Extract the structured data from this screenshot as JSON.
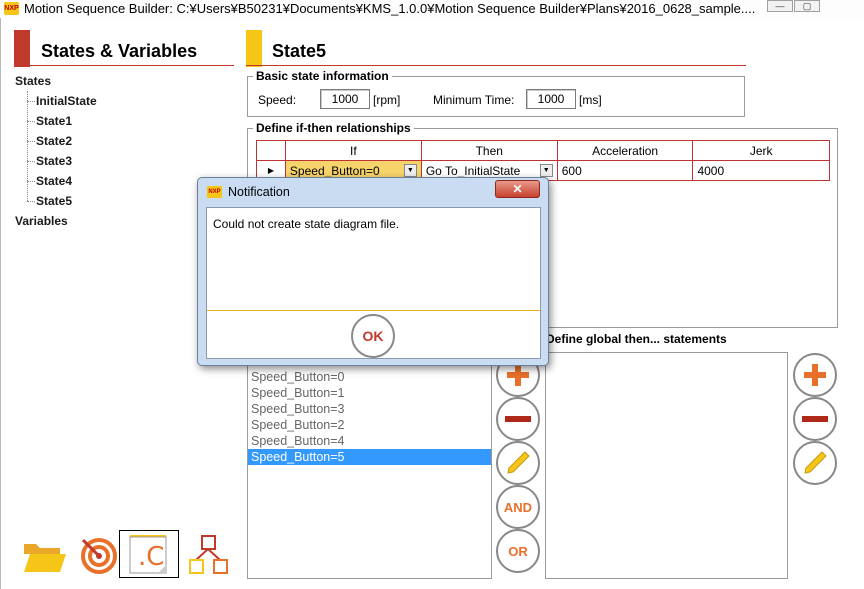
{
  "window": {
    "title": "Motion Sequence Builder: C:¥Users¥B50231¥Documents¥KMS_1.0.0¥Motion Sequence Builder¥Plans¥2016_0628_sample....",
    "app_icon": "nxp-logo-icon",
    "minimize_glyph": "—",
    "maximize_glyph": "▢"
  },
  "sidebar": {
    "title": "States & Variables",
    "states_label": "States",
    "states": [
      "InitialState",
      "State1",
      "State2",
      "State3",
      "State4",
      "State5"
    ],
    "selected_state": "State5",
    "variables_label": "Variables"
  },
  "state_panel": {
    "title": "State5",
    "basic_info": {
      "group_label": "Basic state information",
      "speed_label": "Speed:",
      "speed_value": "1000",
      "speed_unit": "[rpm]",
      "min_time_label": "Minimum Time:",
      "min_time_value": "1000",
      "min_time_unit": "[ms]"
    },
    "if_then": {
      "group_label": "Define if-then relationships",
      "columns": [
        "If",
        "Then",
        "Acceleration",
        "Jerk"
      ],
      "rows": [
        {
          "if": "Speed_Button=0",
          "then": "Go To_InitialState",
          "acceleration": "600",
          "jerk": "4000"
        }
      ]
    }
  },
  "condition_list": {
    "items": [
      "Speed_Button=0",
      "Speed_Button=1",
      "Speed_Button=3",
      "Speed_Button=2",
      "Speed_Button=4",
      "Speed_Button=5"
    ],
    "selected": "Speed_Button=5",
    "and_label": "AND",
    "or_label": "OR"
  },
  "global_then": {
    "label": "Define global then... statements"
  },
  "toolbar_bottom": {
    "icons": [
      "open-folder-icon",
      "target-icon",
      "c-code-file-icon",
      "state-diagram-icon"
    ]
  },
  "dialog": {
    "title": "Notification",
    "message": "Could not create state diagram file.",
    "ok_label": "OK",
    "close_glyph": "✕"
  },
  "colors": {
    "accent_red": "#c0392b",
    "accent_yellow": "#f5c518",
    "orange": "#e8702a",
    "selection_blue": "#3399ff"
  }
}
